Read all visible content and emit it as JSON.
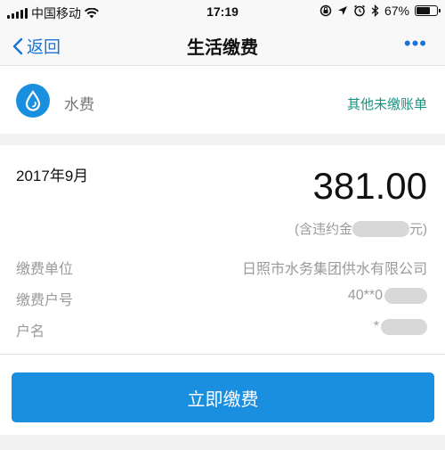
{
  "status_bar": {
    "carrier": "中国移动",
    "time": "17:19",
    "battery_percent": "67%",
    "battery_level": 0.67
  },
  "nav": {
    "back_label": "返回",
    "title": "生活缴费",
    "more_label": "•••"
  },
  "service": {
    "icon": "water-drop-icon",
    "name": "水费",
    "other_bills_label": "其他未缴账单"
  },
  "bill": {
    "period": "2017年9月",
    "amount": "381.00",
    "late_fee_prefix": "(含违约金",
    "late_fee_suffix": "元)"
  },
  "details": [
    {
      "label": "缴费单位",
      "value": "日照市水务集团供水有限公司"
    },
    {
      "label": "缴费户号",
      "value": "40**0"
    },
    {
      "label": "户名",
      "value": "*"
    }
  ],
  "pay_button_label": "立即缴费",
  "colors": {
    "accent": "#1a8fe0",
    "link": "#1a73d6",
    "secondary_link": "#1a9080"
  }
}
